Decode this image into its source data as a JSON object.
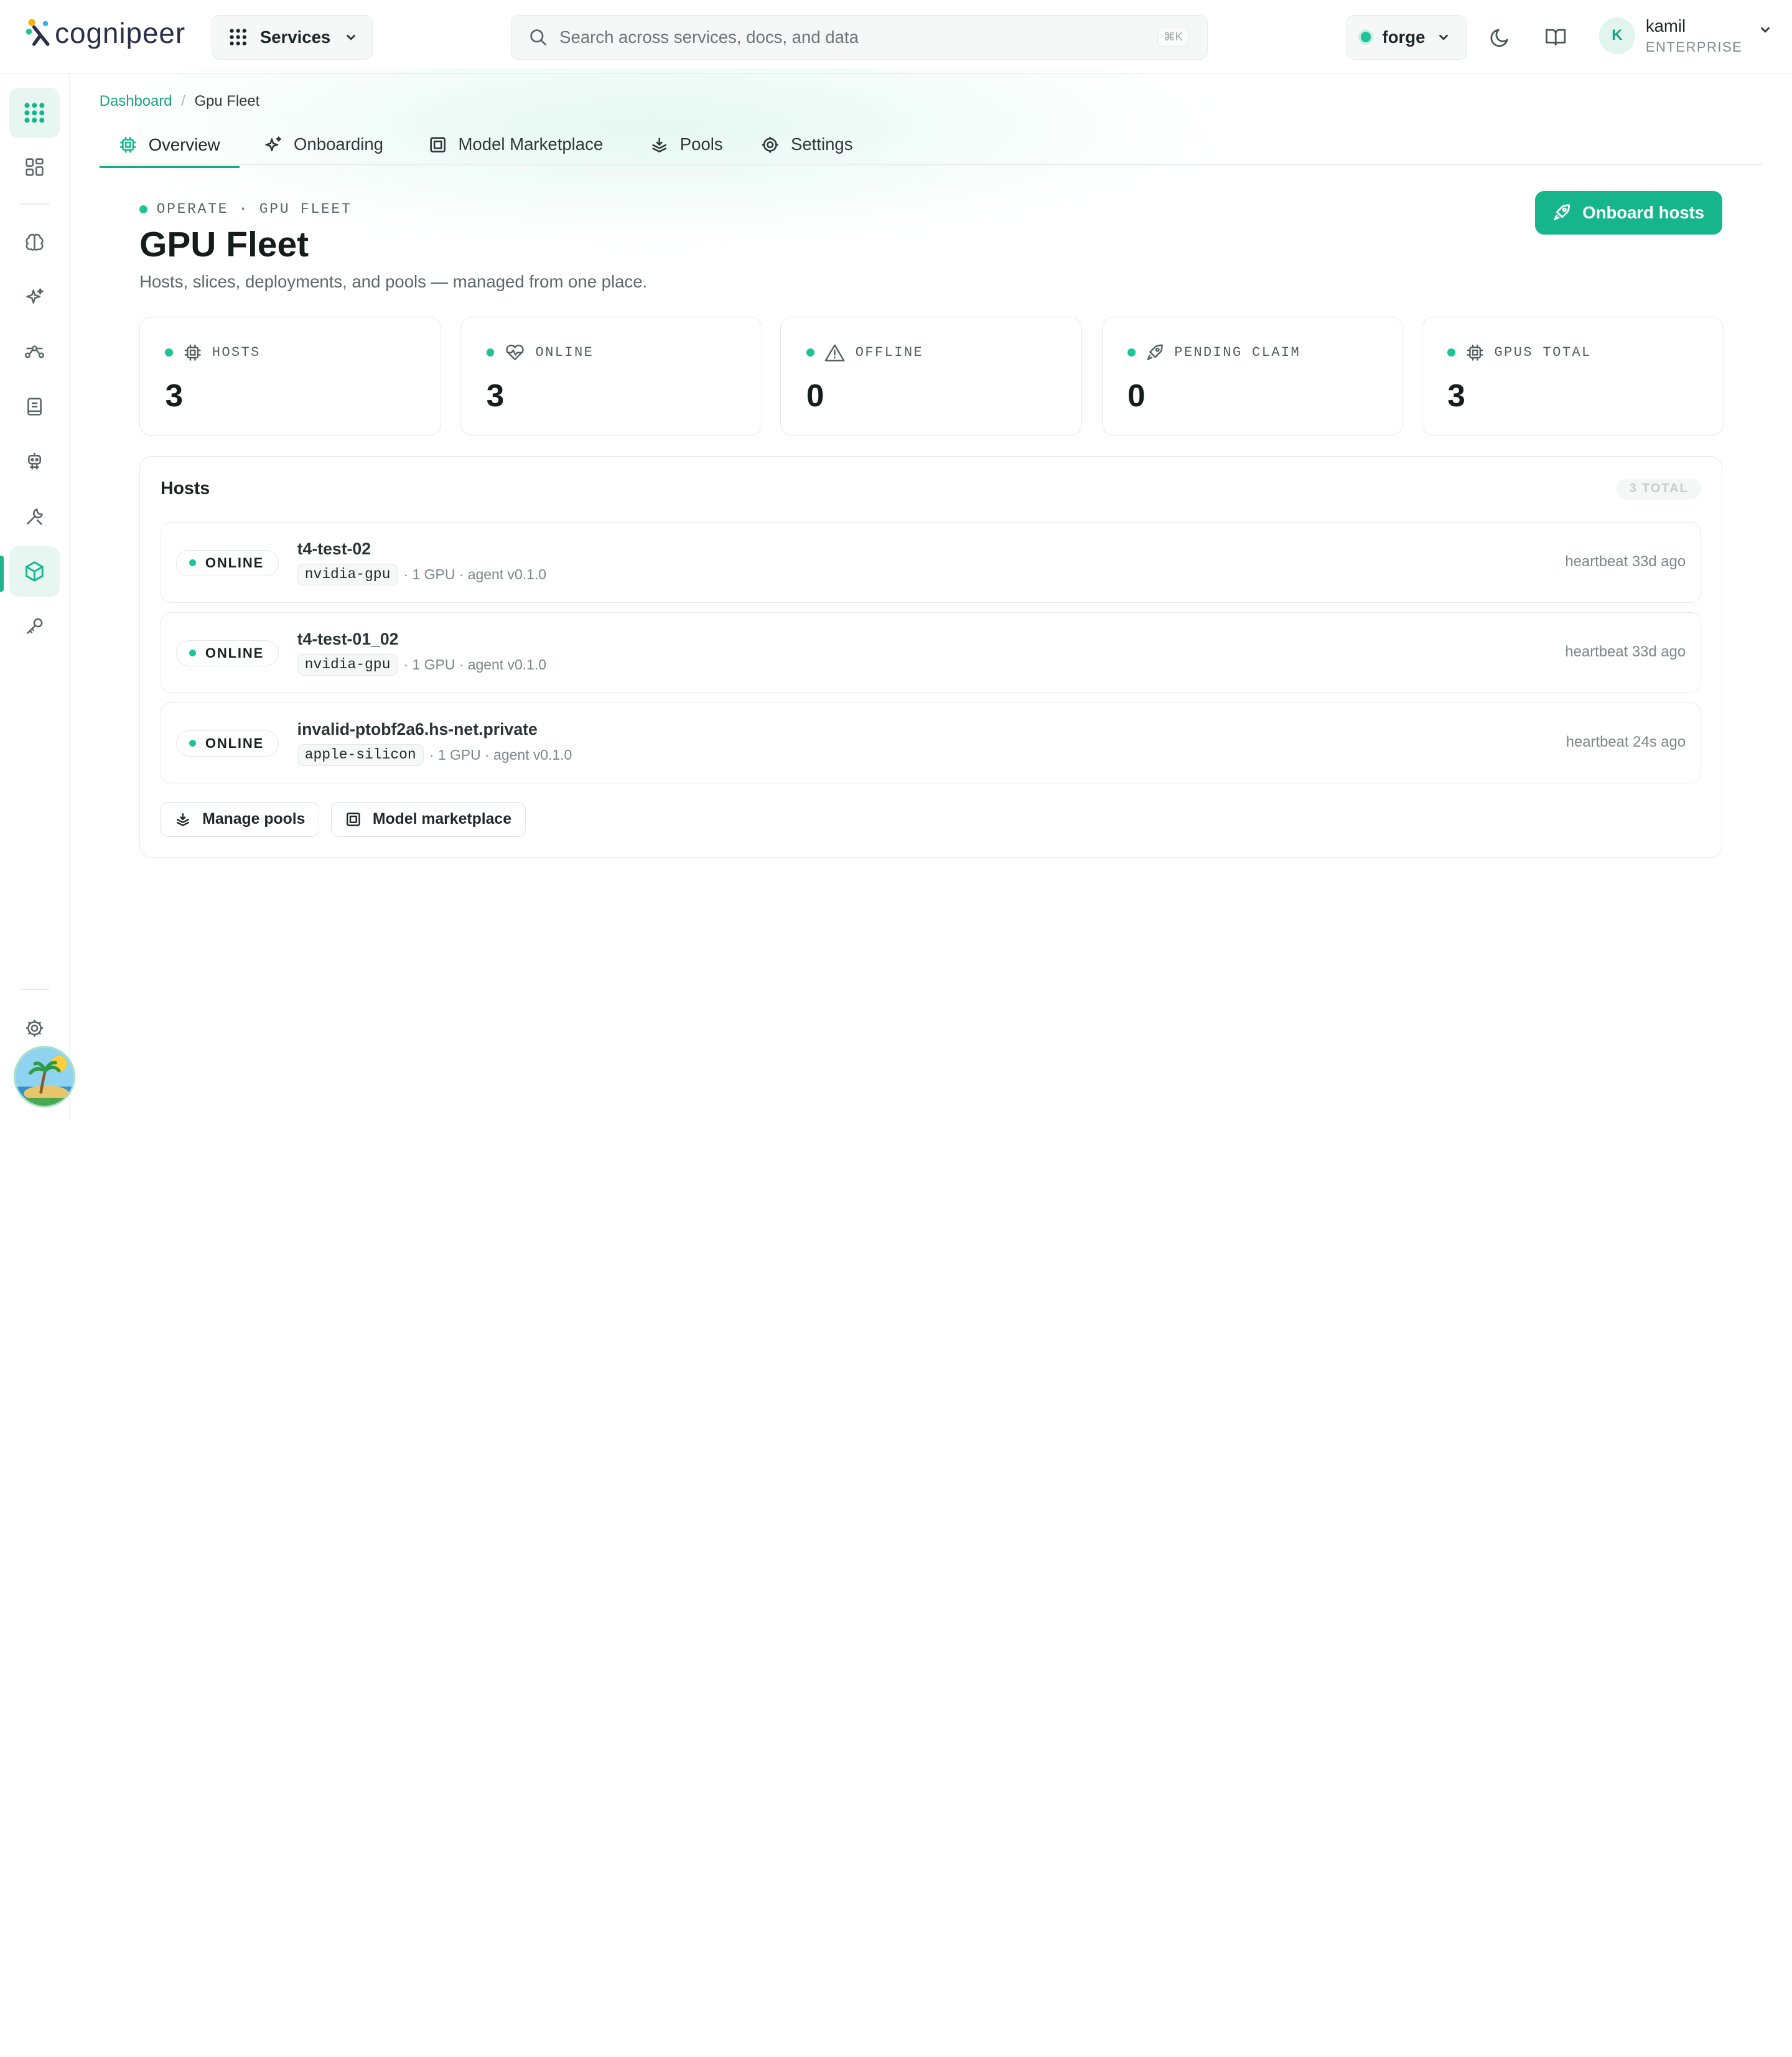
{
  "header": {
    "logo_text": "cognipeer",
    "services_label": "Services",
    "search_placeholder": "Search across services, docs, and data",
    "search_shortcut": "⌘K",
    "workspace": "forge",
    "user_name": "kamil",
    "user_initial": "K",
    "user_tier": "ENTERPRISE"
  },
  "sidebar": {
    "items": [
      {
        "icon": "apps-grid-icon",
        "active": true
      },
      {
        "icon": "dashboard-icon"
      },
      {
        "icon": "brain-icon"
      },
      {
        "icon": "sparkles-icon"
      },
      {
        "icon": "flow-icon"
      },
      {
        "icon": "book-icon"
      },
      {
        "icon": "robot-icon"
      },
      {
        "icon": "tools-icon"
      },
      {
        "icon": "cube-icon",
        "active": true
      },
      {
        "icon": "key-icon"
      },
      {
        "icon": "settings-icon"
      }
    ]
  },
  "breadcrumb": {
    "root": "Dashboard",
    "separator": "/",
    "current": "Gpu Fleet"
  },
  "tabs": [
    {
      "label": "Overview",
      "icon": "chip-icon",
      "active": true
    },
    {
      "label": "Onboarding",
      "icon": "sparkles-icon"
    },
    {
      "label": "Model Marketplace",
      "icon": "box-icon"
    },
    {
      "label": "Pools",
      "icon": "layers-icon"
    },
    {
      "label": "Settings",
      "icon": "gear-icon"
    }
  ],
  "page": {
    "eyebrow": "OPERATE · GPU FLEET",
    "title": "GPU Fleet",
    "subtitle": "Hosts, slices, deployments, and pools — managed from one place.",
    "primary_action": "Onboard hosts"
  },
  "stats": [
    {
      "label": "HOSTS",
      "value": "3",
      "icon": "chip-icon"
    },
    {
      "label": "ONLINE",
      "value": "3",
      "icon": "heart-pulse-icon"
    },
    {
      "label": "OFFLINE",
      "value": "0",
      "icon": "warning-icon"
    },
    {
      "label": "PENDING CLAIM",
      "value": "0",
      "icon": "rocket-icon"
    },
    {
      "label": "GPUS TOTAL",
      "value": "3",
      "icon": "chip-icon"
    }
  ],
  "hosts": {
    "title": "Hosts",
    "total": "3 TOTAL",
    "rows": [
      {
        "status": "ONLINE",
        "name": "t4-test-02",
        "type": "nvidia-gpu",
        "details": "· 1 GPU · agent v0.1.0",
        "heartbeat": "heartbeat 33d ago"
      },
      {
        "status": "ONLINE",
        "name": "t4-test-01_02",
        "type": "nvidia-gpu",
        "details": "· 1 GPU · agent v0.1.0",
        "heartbeat": "heartbeat 33d ago"
      },
      {
        "status": "ONLINE",
        "name": "invalid-ptobf2a6.hs-net.private",
        "type": "apple-silicon",
        "details": "· 1 GPU · agent v0.1.0",
        "heartbeat": "heartbeat 24s ago"
      }
    ],
    "actions": [
      "Manage pools",
      "Model marketplace"
    ]
  },
  "colors": {
    "accent": "#16b58c",
    "online": "#1ec396",
    "text": "#141c1c"
  }
}
